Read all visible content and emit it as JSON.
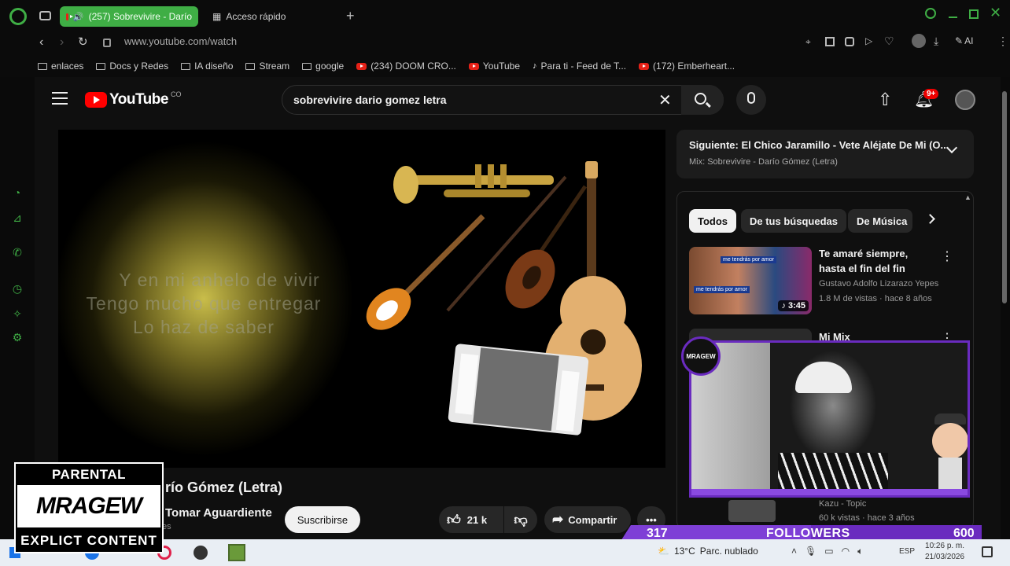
{
  "browser": {
    "active_tab_title": "(257) Sobrevivire - Darío",
    "second_tab_title": "Acceso rápido",
    "url": "www.youtube.com/watch",
    "ai_label": "AI"
  },
  "bookmarks": [
    {
      "label": "enlaces",
      "icon": "folder-icon"
    },
    {
      "label": "Docs y Redes",
      "icon": "folder-icon"
    },
    {
      "label": "IA diseño",
      "icon": "folder-icon"
    },
    {
      "label": "Stream",
      "icon": "folder-icon"
    },
    {
      "label": "google",
      "icon": "folder-icon"
    },
    {
      "label": "(234) DOOM CRO...",
      "icon": "youtube-icon"
    },
    {
      "label": "YouTube",
      "icon": "youtube-icon"
    },
    {
      "label": "Para ti - Feed de T...",
      "icon": "tiktok-icon"
    },
    {
      "label": "(172) Emberheart...",
      "icon": "youtube-icon"
    }
  ],
  "youtube": {
    "logo_text": "YouTube",
    "logo_country": "CO",
    "search_value": "sobrevivire dario gomez letra",
    "notifications_badge": "9+",
    "lyrics": [
      "Y en mi anhelo de vivir",
      "Tengo mucho que entregar",
      "Lo haz de saber"
    ],
    "video_title_visible": "río Gómez (Letra)",
    "channel_name_visible": "Tomar Aguardiente",
    "channel_sub_visible": "es",
    "subscribe_label": "Suscribirse",
    "likes": "21 k",
    "share_label": "Compartir",
    "up_next_title": "Siguiente: El Chico Jaramillo - Vete Aléjate De Mi (O...",
    "up_next_mix": "Mix: Sobrevivire - Darío Gómez (Letra)",
    "chips": [
      "Todos",
      "De tus búsquedas",
      "De Música"
    ],
    "recommendations": [
      {
        "title_line1": "Te amaré siempre,",
        "title_line2": "hasta el fin del fin",
        "channel": "Gustavo Adolfo Lizarazo Yepes",
        "meta": "1.8 M de vistas · hace 8 años",
        "duration": "3:45",
        "thumb_caption_top": "me tendrás por amor",
        "thumb_caption_bottom": "me tendrás por amor"
      },
      {
        "title_line1": "Mi Mix",
        "channel": "Kazu - Topic",
        "meta": "60 k vistas · hace 3 años"
      }
    ]
  },
  "overlay": {
    "followers_current": "317",
    "followers_label": "FOLLOWERS",
    "followers_goal": "600",
    "followers_progress": 0.528,
    "advisory_top": "PARENTAL ADVISORY",
    "advisory_logo": "MRAGEW",
    "advisory_bottom": "EXPLICT CONTENT",
    "webcam_logo": "MRAGEW"
  },
  "taskbar": {
    "weather_temp": "13°C",
    "weather_text": "Parc. nublado",
    "language": "ESP",
    "time": "10:26 p. m.",
    "date": "21/03/2026"
  },
  "colors": {
    "opera_green": "#3fae45",
    "youtube_red": "#ff0000",
    "stream_purple": "#6a2bbf"
  }
}
